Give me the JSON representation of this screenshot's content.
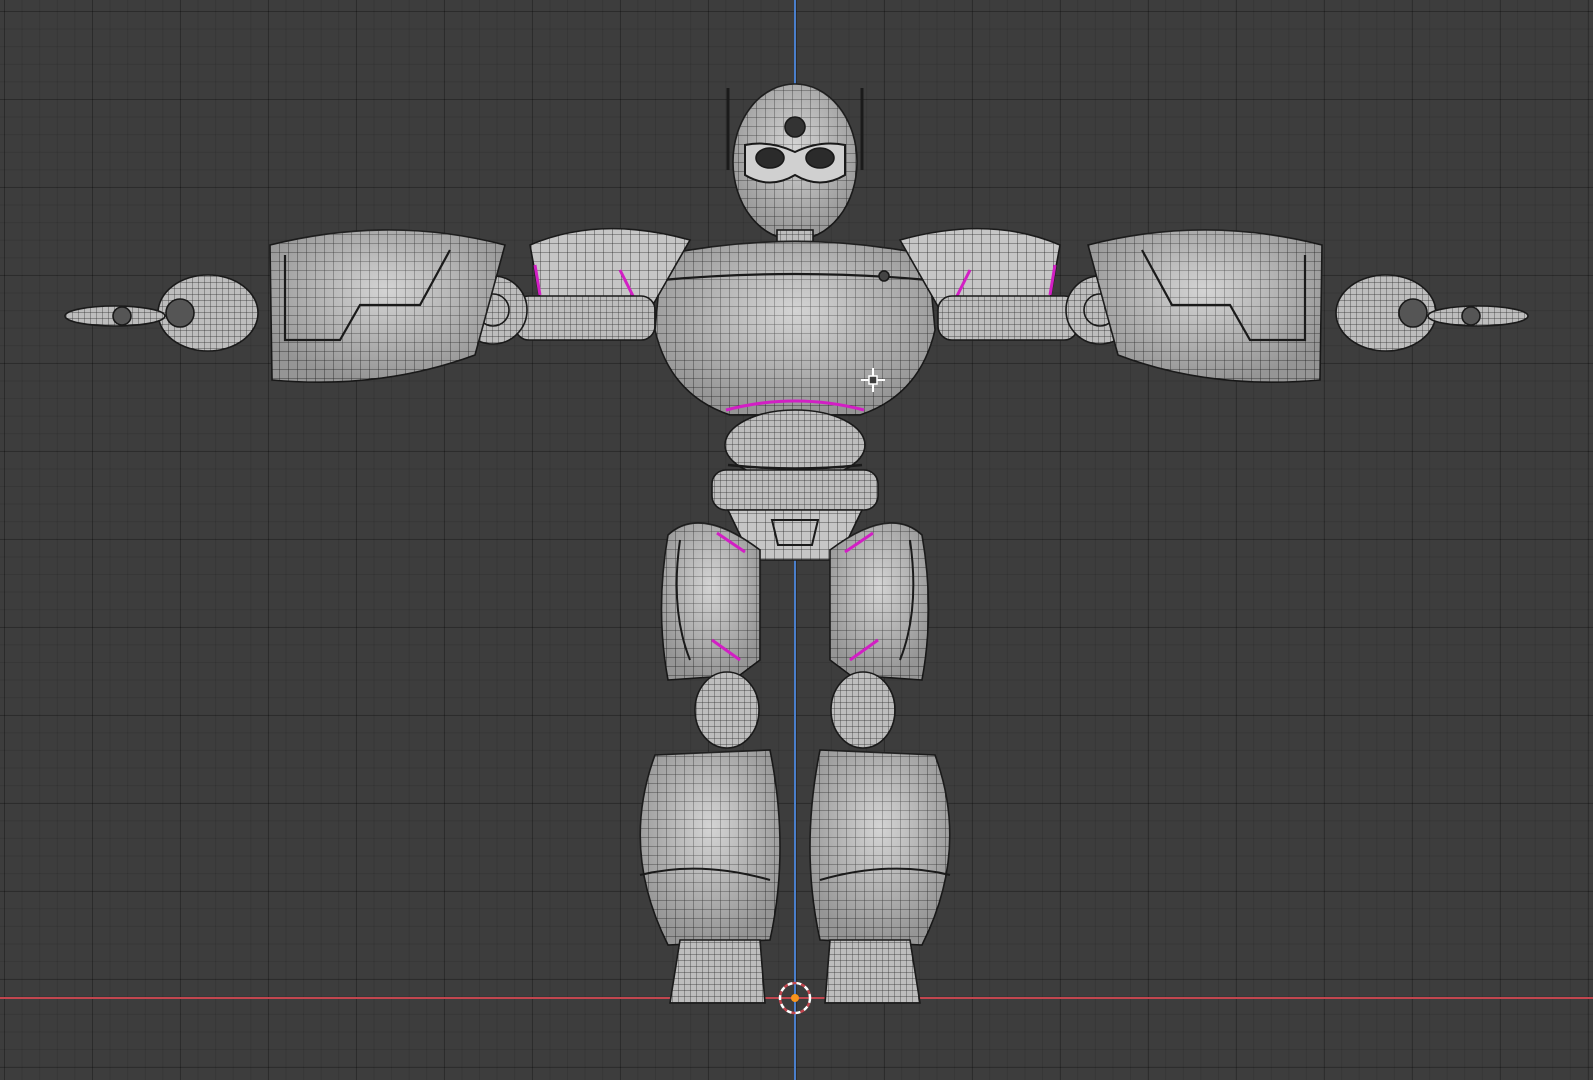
{
  "viewport": {
    "background": "#3d3d3d",
    "axis_z_color": "#4a7fcc",
    "axis_x_color": "#c2464f",
    "seam_color": "#d21fc4",
    "mesh_fill": "#c4c4c4",
    "wire_color": "#1a1a1a",
    "origin_color": "#f7941d"
  },
  "objects": {
    "active": "robot-mesh"
  },
  "icons": {
    "cursor": "3d-cursor-icon",
    "origin": "world-origin-icon"
  }
}
